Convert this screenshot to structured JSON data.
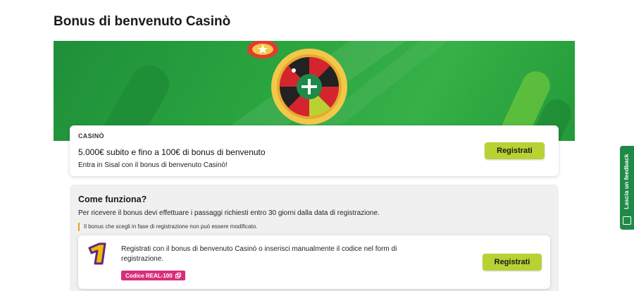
{
  "page": {
    "title": "Bonus di benvenuto Casinò"
  },
  "promo": {
    "category": "CASINÒ",
    "headline": "5.000€ subito e fino a 100€ di bonus di benvenuto",
    "subtitle": "Entra in Sisal con il bonus di benvenuto Casinò!",
    "cta_label": "Registrati"
  },
  "how_it_works": {
    "title": "Come funziona?",
    "description": "Per ricevere il bonus devi effettuare i passaggi richiesti entro 30 giorni dalla data di registrazione.",
    "note": "Il bonus che scegli in fase di registrazione non può essere modificato.",
    "steps": [
      {
        "number": "1",
        "text": "Registrati con il bonus di benvenuto Casinò o inserisci manualmente il codice nel form di registrazione.",
        "code_label": "Codice REAL-100",
        "copy_icon": "copy-icon",
        "cta_label": "Registrati"
      }
    ]
  },
  "feedback_tab": {
    "label": "Lascia un feedback",
    "icon": "feedback-icon"
  },
  "colors": {
    "accent_button": "#b9d233",
    "hero_green": "#2aa43f",
    "code_badge": "#d62f7c",
    "note_bar": "#f0a020",
    "feedback_green": "#1f8a47"
  }
}
